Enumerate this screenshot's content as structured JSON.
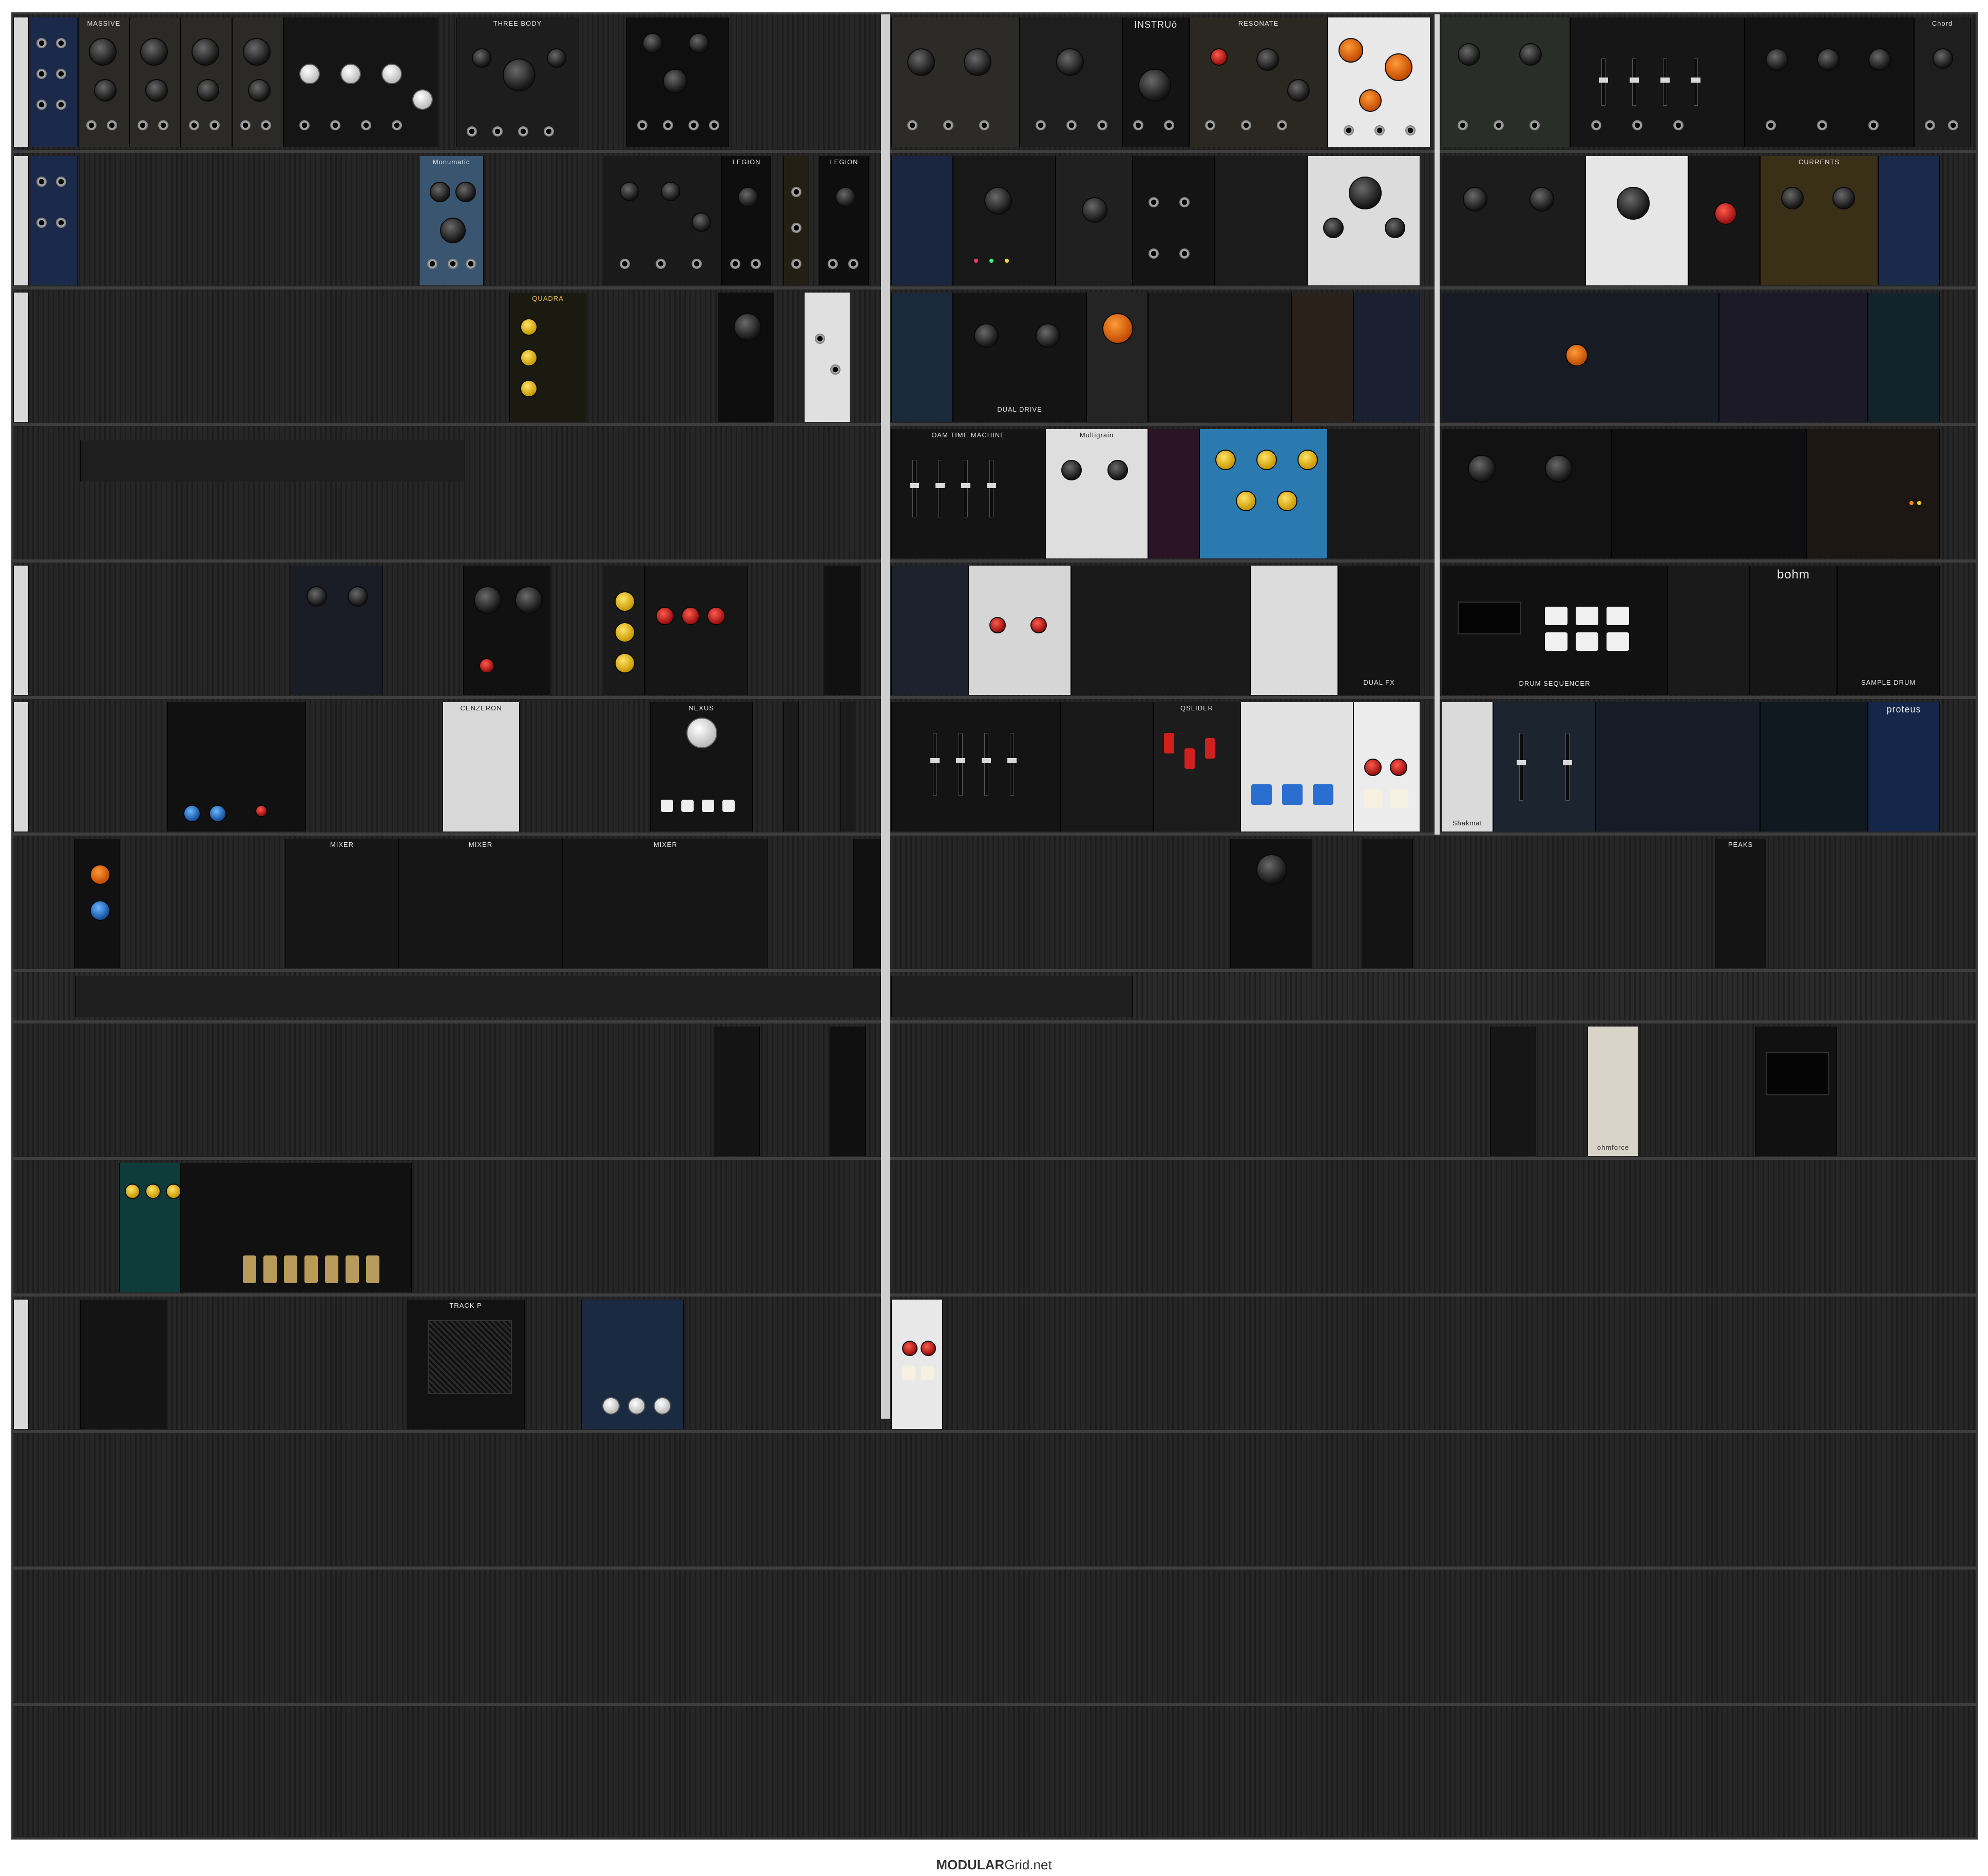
{
  "footer": {
    "brand_bold": "MODULAR",
    "brand_rest": "Grid.net"
  },
  "module_labels": {
    "massiv": "MASSIVE",
    "three_body": "THREE BODY",
    "instruo": "INSTRUō",
    "resonate": "RESONATE",
    "monumatic": "Monumatic",
    "legion_1": "LEGION",
    "legion_2": "LEGION",
    "quadra": "QUADRA",
    "currents": "CURRENTS",
    "oam_time_machine": "OAM TIME MACHINE",
    "multigrain": "Multigrain",
    "dual_drive": "DUAL DRIVE",
    "drum_sequencer": "DRUM SEQUENCER",
    "bohm": "bohm",
    "sample_drum": "SAMPLE DRUM",
    "proteus": "proteus",
    "qslider": "QSLIDER",
    "chord": "Chord",
    "ohmforce": "ohmforce",
    "shakmat": "Shakmat",
    "dual_fx": "DUAL FX",
    "cenzeron": "CENZERON",
    "nexus": "NEXUS",
    "track_p": "TRACK P",
    "peaks": "PEAKS",
    "mixer_1": "MIXER",
    "mixer_2": "MIXER",
    "mixer_3": "MIXER"
  },
  "colors": {
    "rack_bg": "#1c1c1c",
    "rail": "#3e3e3e",
    "accent_orange": "#ff6a1a",
    "accent_yellow": "#ffd21a",
    "accent_blue": "#2a6fd0",
    "accent_red": "#d02020"
  }
}
